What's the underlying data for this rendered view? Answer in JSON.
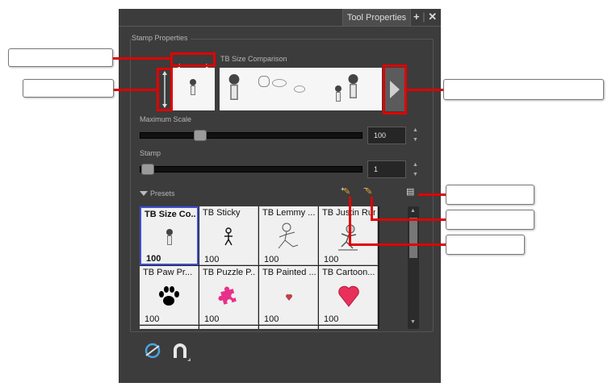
{
  "window": {
    "tab_title": "Tool Properties",
    "add_icon": "+",
    "close_icon": "✕"
  },
  "stamp_properties": {
    "label": "Stamp Properties",
    "size_comparison_label": "TB Size Comparison"
  },
  "maximum_scale": {
    "label": "Maximum Scale",
    "value": "100",
    "fraction": 0.27
  },
  "stamp": {
    "label": "Stamp",
    "value": "1",
    "fraction": 0.0
  },
  "presets": {
    "label": "Presets",
    "items": [
      {
        "name": "TB Size Co...",
        "size": "100",
        "selected": true,
        "icon": "tiny-figure"
      },
      {
        "name": "TB Sticky",
        "size": "100",
        "selected": false,
        "icon": "stick-figure"
      },
      {
        "name": "TB Lemmy ...",
        "size": "100",
        "selected": false,
        "icon": "running-figure"
      },
      {
        "name": "TB Justin Run",
        "size": "100",
        "selected": false,
        "icon": "running-character"
      },
      {
        "name": "TB Paw Pr...",
        "size": "100",
        "selected": false,
        "icon": "paw-print"
      },
      {
        "name": "TB Puzzle P...",
        "size": "100",
        "selected": false,
        "icon": "puzzle-piece"
      },
      {
        "name": "TB Painted ...",
        "size": "100",
        "selected": false,
        "icon": "painted-heart"
      },
      {
        "name": "TB Cartoon...",
        "size": "100",
        "selected": false,
        "icon": "cartoon-heart"
      }
    ]
  },
  "colors": {
    "panel": "#3c3c3c",
    "highlight": "#e00000",
    "selection": "#3f4fd6",
    "pink": "#e8308a"
  }
}
